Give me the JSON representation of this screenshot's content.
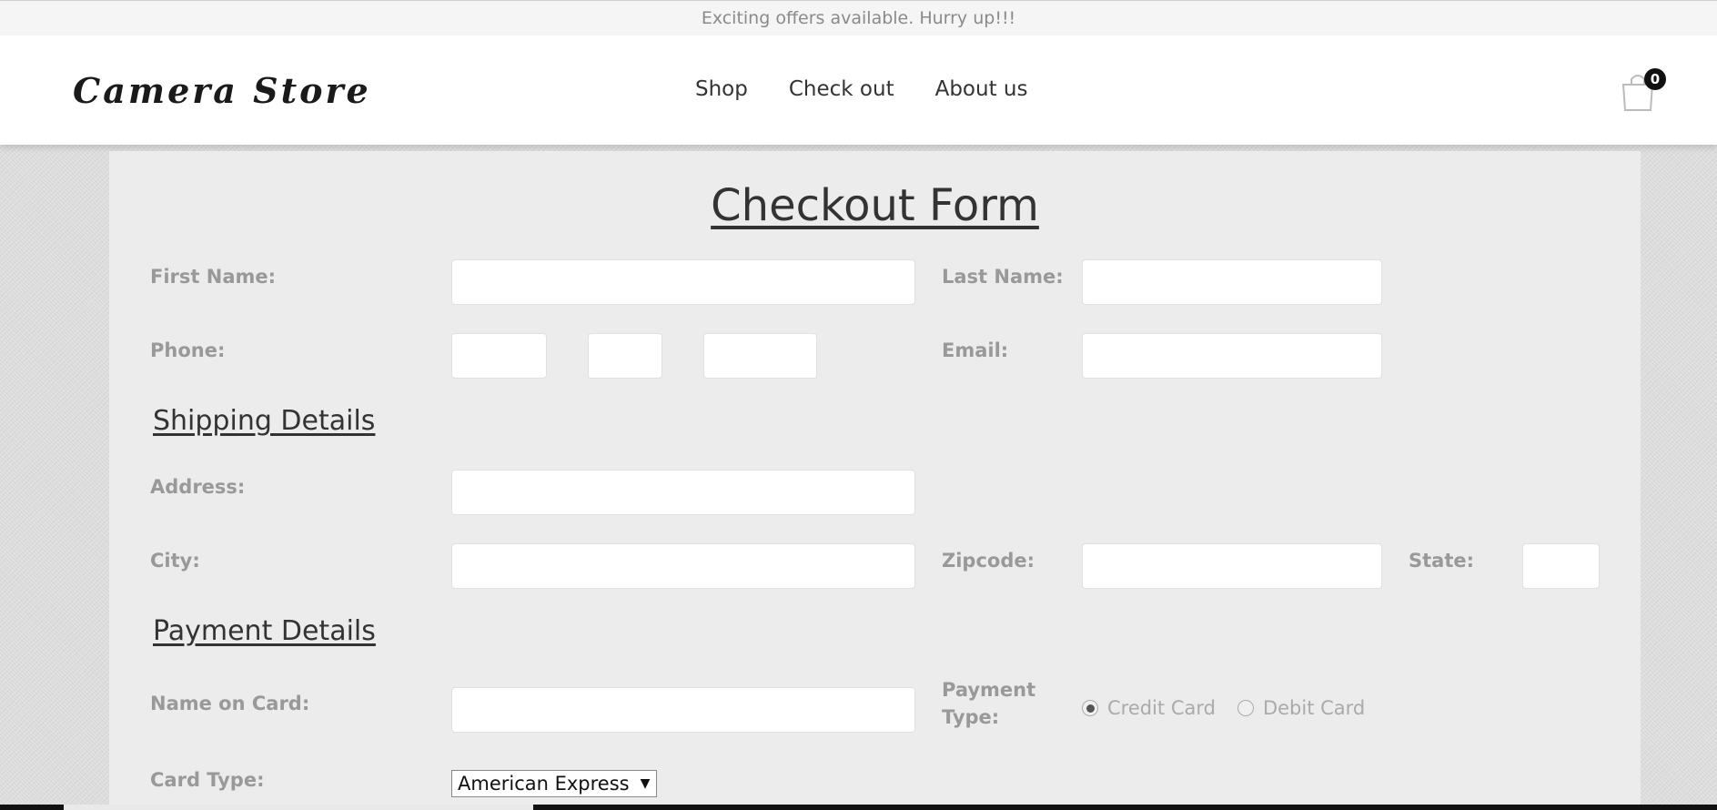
{
  "topbar": {
    "text": "Exciting offers available. Hurry up!!!"
  },
  "header": {
    "logo": "Camera Store",
    "nav": [
      "Shop",
      "Check out",
      "About us"
    ],
    "cart_count": "0"
  },
  "form": {
    "title": "Checkout Form",
    "first_name_label": "First Name:",
    "last_name_label": "Last Name:",
    "phone_label": "Phone:",
    "email_label": "Email:",
    "shipping_heading": "Shipping Details",
    "address_label": "Address:",
    "city_label": "City:",
    "zipcode_label": "Zipcode:",
    "state_label": "State:",
    "payment_heading": "Payment Details",
    "name_on_card_label": "Name on Card:",
    "payment_type_label_1": "Payment",
    "payment_type_label_2": "Type:",
    "payment_options": [
      "Credit Card",
      "Debit Card"
    ],
    "payment_selected": "Credit Card",
    "card_type_label": "Card Type:",
    "card_type_value": "American Express"
  },
  "colors": {
    "accent": "#333333",
    "label": "#999999",
    "panel": "#ececec"
  }
}
